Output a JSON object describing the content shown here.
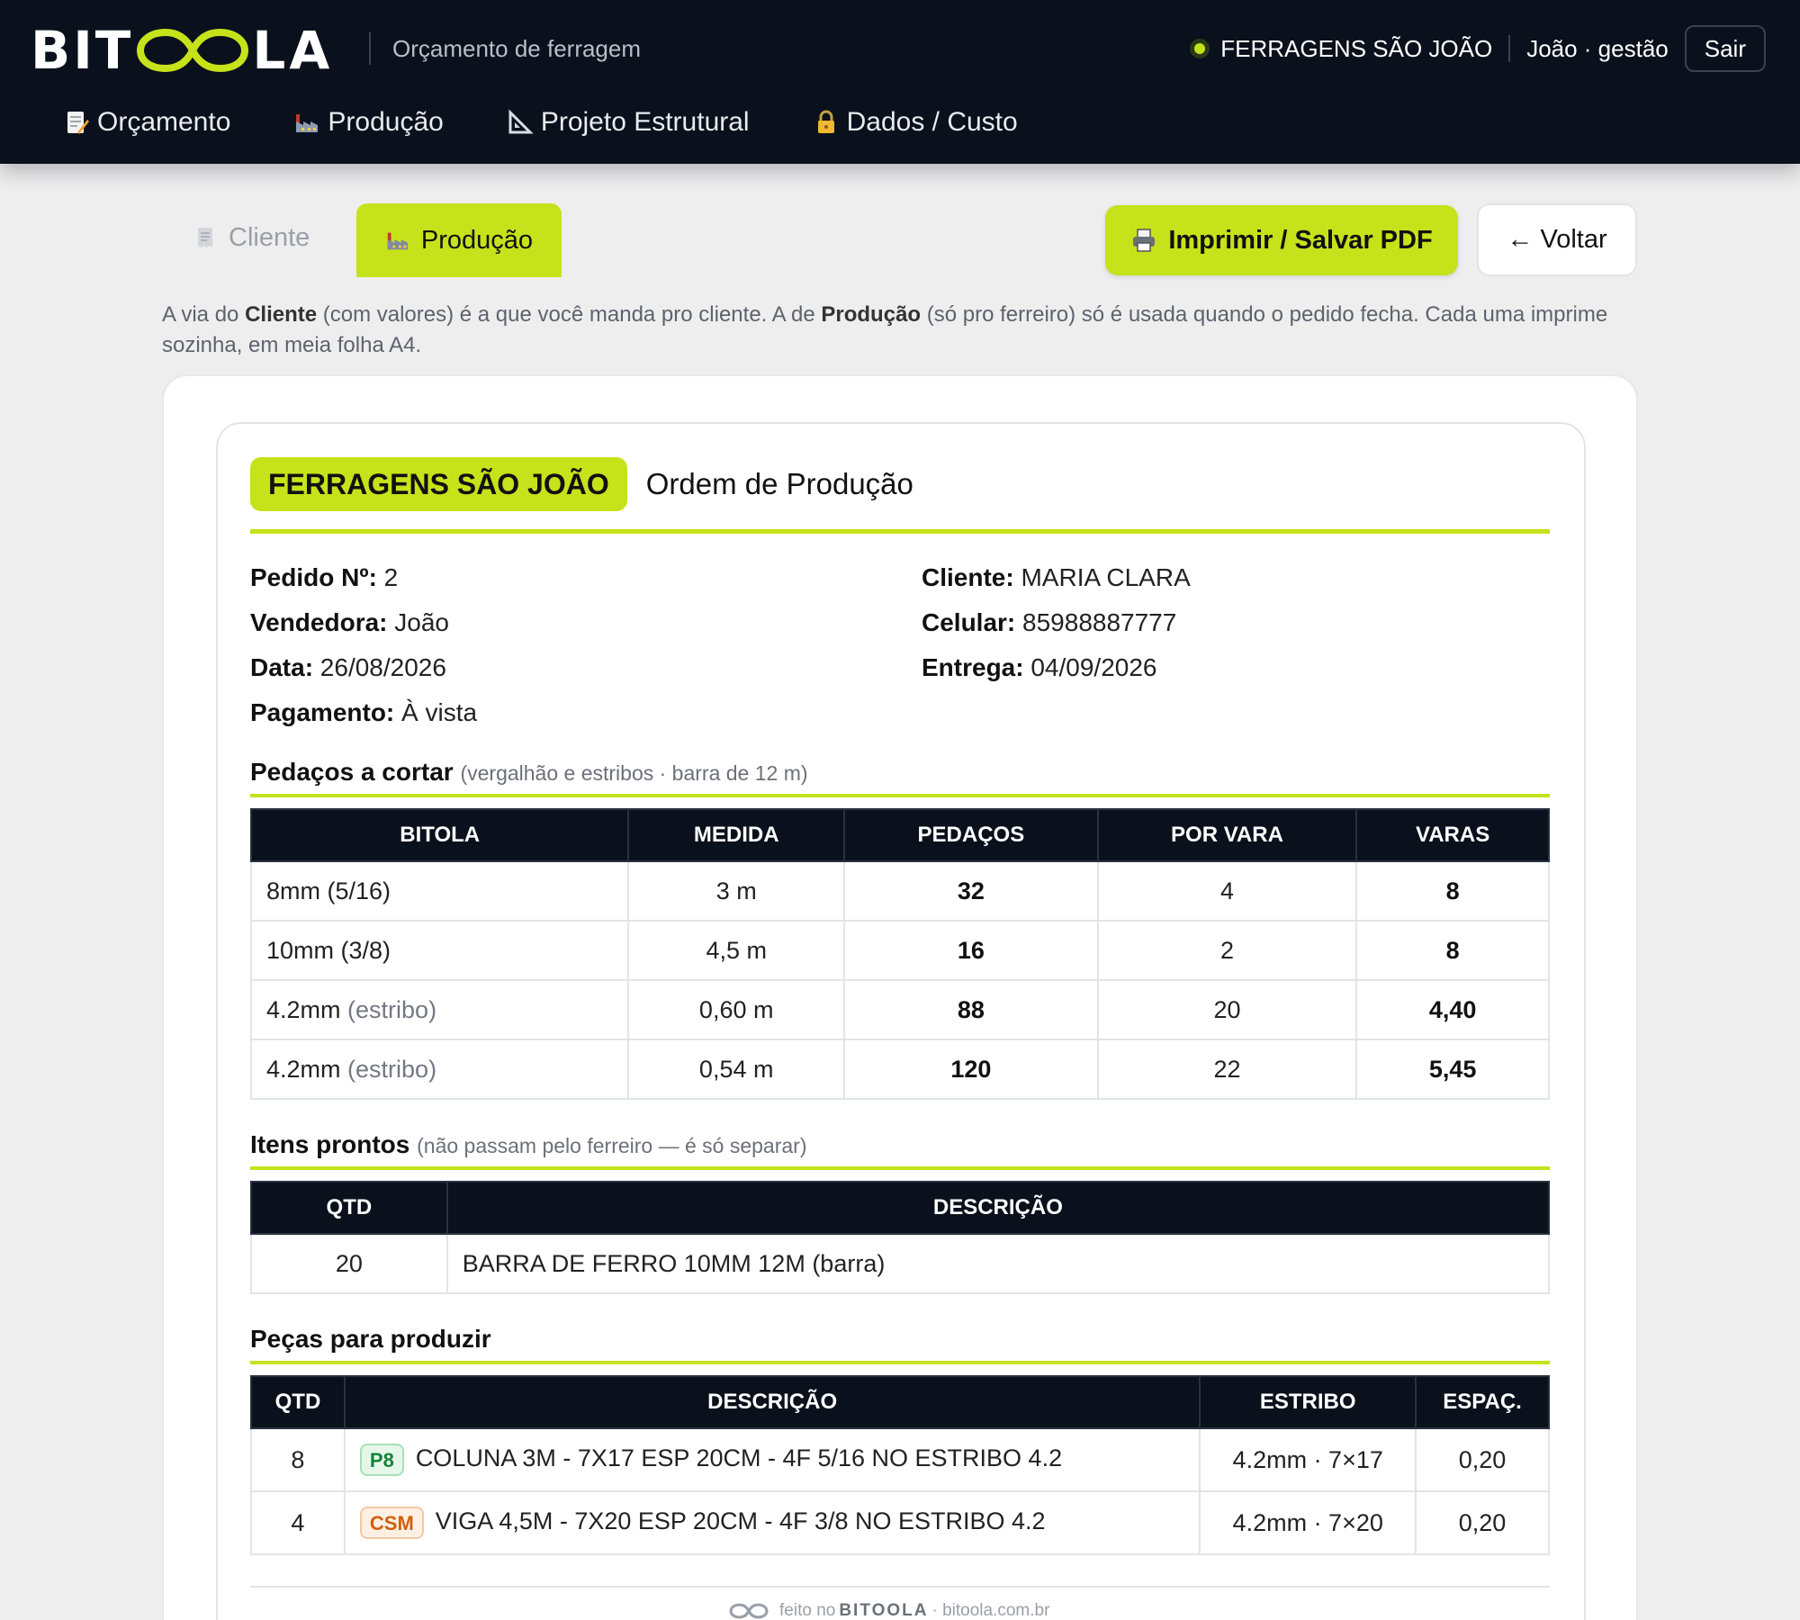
{
  "header": {
    "logo_text_left": "BIT",
    "logo_text_right": "LA",
    "subtitle": "Orçamento de ferragem",
    "company": "FERRAGENS SÃO JOÃO",
    "user": "João · gestão",
    "logout_label": "Sair",
    "accent_color": "#c6e21a",
    "bg_color": "#0a111c"
  },
  "nav": [
    {
      "label": "Orçamento",
      "icon": "memo-icon"
    },
    {
      "label": "Produção",
      "icon": "factory-icon"
    },
    {
      "label": "Projeto Estrutural",
      "icon": "triangle-ruler-icon"
    },
    {
      "label": "Dados / Custo",
      "icon": "lock-icon"
    }
  ],
  "tabs": {
    "cliente": "Cliente",
    "producao": "Produção",
    "active": "producao"
  },
  "actions": {
    "print_label": "Imprimir / Salvar PDF",
    "back_label": "← Voltar"
  },
  "help": {
    "t1": "A via do ",
    "b1": "Cliente",
    "t2": " (com valores) é a que você manda pro cliente. A de ",
    "b2": "Produção",
    "t3": " (só pro ferreiro) só é usada quando o pedido fecha. Cada uma imprime sozinha, em meia folha A4."
  },
  "doc": {
    "brand": "FERRAGENS SÃO JOÃO",
    "title": "Ordem de Produção",
    "fields": {
      "pedido_label": "Pedido Nº:",
      "pedido": "2",
      "vendedora_label": "Vendedora:",
      "vendedora": "João",
      "data_label": "Data:",
      "data": "26/08/2026",
      "pagamento_label": "Pagamento:",
      "pagamento": "À vista",
      "cliente_label": "Cliente:",
      "cliente": "MARIA CLARA",
      "celular_label": "Celular:",
      "celular": "85988887777",
      "entrega_label": "Entrega:",
      "entrega": "04/09/2026"
    },
    "cuts": {
      "title": "Pedaços a cortar",
      "note": "(vergalhão e estribos · barra de 12 m)",
      "headers": [
        "BITOLA",
        "MEDIDA",
        "PEDAÇOS",
        "POR VARA",
        "VARAS"
      ],
      "rows": [
        {
          "bitola": "8mm (5/16)",
          "suffix": "",
          "medida": "3 m",
          "pedacos": "32",
          "por_vara": "4",
          "varas": "8"
        },
        {
          "bitola": "10mm (3/8)",
          "suffix": "",
          "medida": "4,5 m",
          "pedacos": "16",
          "por_vara": "2",
          "varas": "8"
        },
        {
          "bitola": "4.2mm",
          "suffix": "(estribo)",
          "medida": "0,60 m",
          "pedacos": "88",
          "por_vara": "20",
          "varas": "4,40"
        },
        {
          "bitola": "4.2mm",
          "suffix": "(estribo)",
          "medida": "0,54 m",
          "pedacos": "120",
          "por_vara": "22",
          "varas": "5,45"
        }
      ]
    },
    "ready": {
      "title": "Itens prontos",
      "note": "(não passam pelo ferreiro — é só separar)",
      "headers": [
        "QTD",
        "DESCRIÇÃO"
      ],
      "rows": [
        {
          "qtd": "20",
          "descricao": "BARRA DE FERRO 10MM 12M (barra)"
        }
      ]
    },
    "pieces": {
      "title": "Peças para produzir",
      "headers": [
        "QTD",
        "DESCRIÇÃO",
        "ESTRIBO",
        "ESPAÇ."
      ],
      "rows": [
        {
          "qtd": "8",
          "tag": "P8",
          "descricao": "COLUNA 3M - 7X17 ESP 20CM - 4F 5/16 NO ESTRIBO 4.2",
          "estribo": "4.2mm · 7×17",
          "espac": "0,20"
        },
        {
          "qtd": "4",
          "tag": "CSM",
          "descricao": "VIGA 4,5M - 7X20 ESP 20CM - 4F 3/8 NO ESTRIBO 4.2",
          "estribo": "4.2mm · 7×20",
          "espac": "0,20"
        }
      ]
    }
  },
  "footer": {
    "pre": "feito no",
    "brand": "BITOOLA",
    "post": "· bitoola.com.br"
  }
}
